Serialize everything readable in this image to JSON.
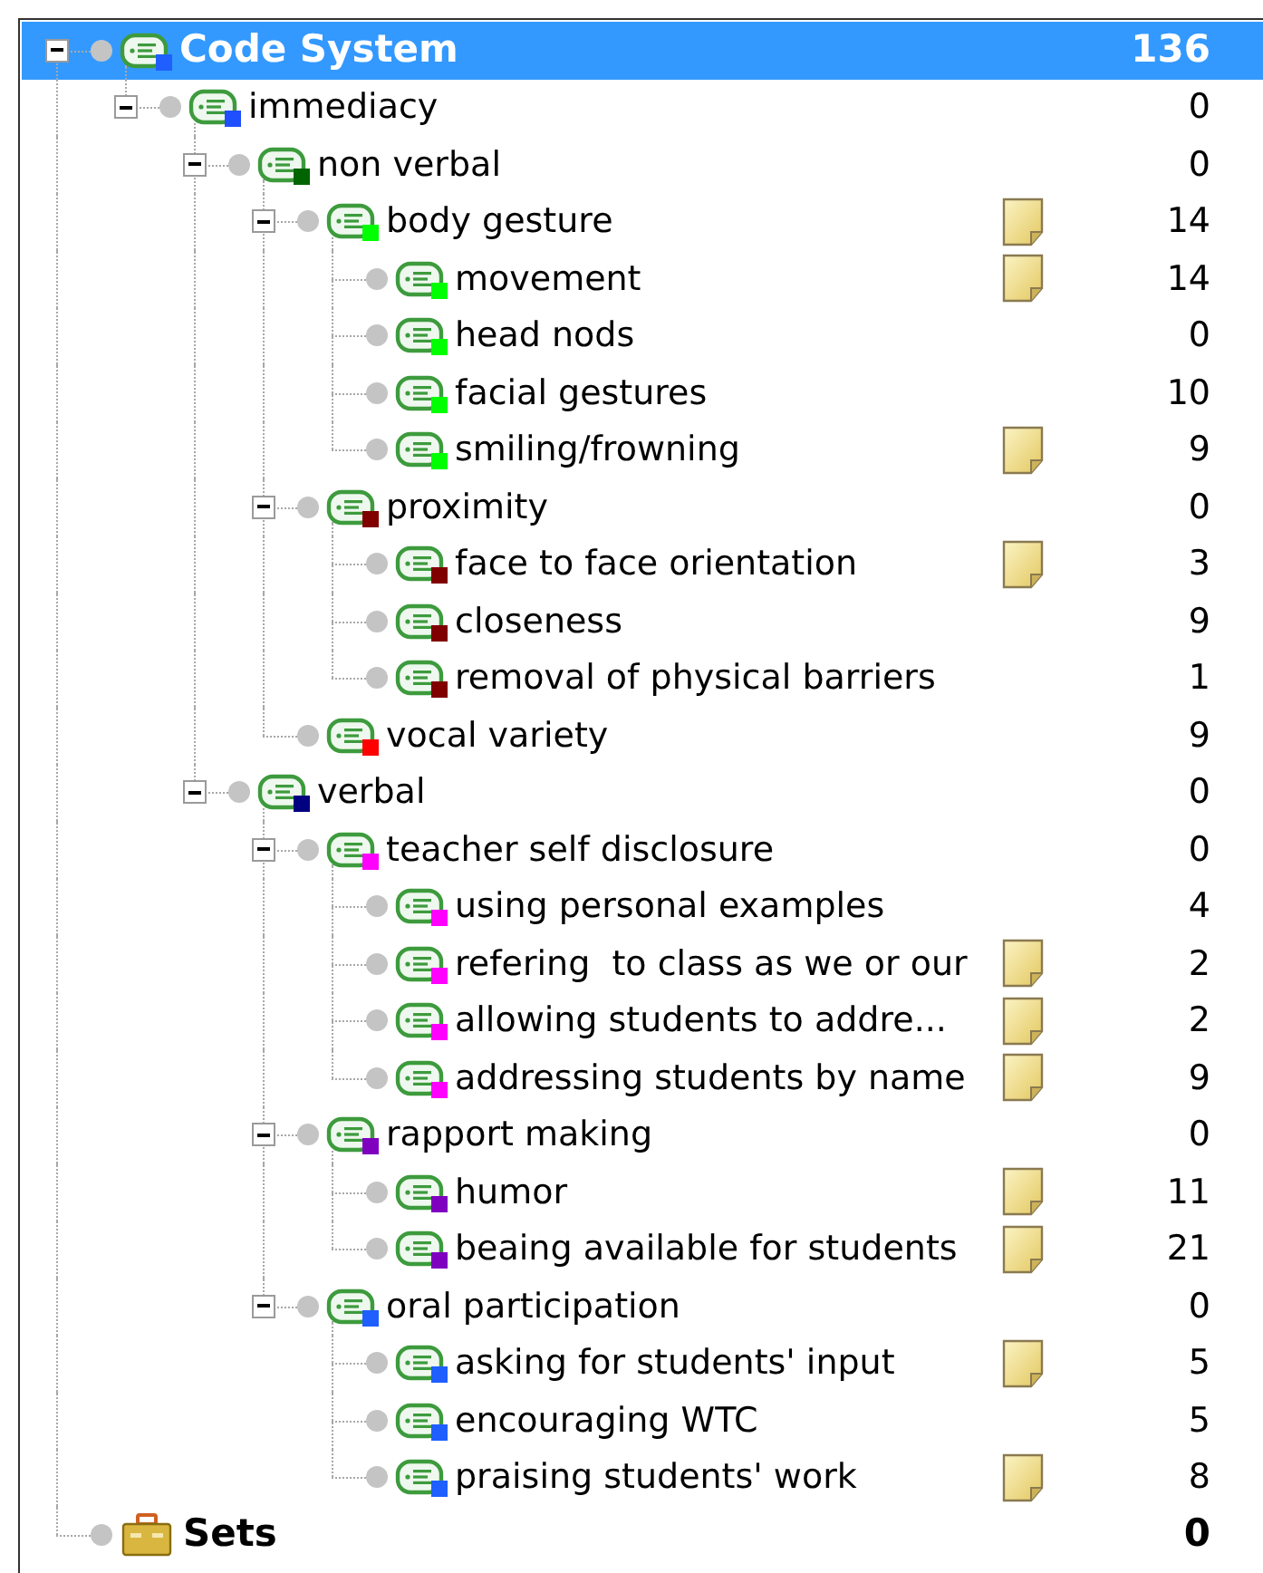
{
  "tree": [
    {
      "kind": "code-system",
      "name": "Code System",
      "count": "136",
      "selected": true,
      "expanded": true,
      "memo": false,
      "color": "#1f5fff",
      "children": [
        {
          "kind": "code",
          "name": "immediacy",
          "count": "0",
          "selected": false,
          "expanded": true,
          "memo": false,
          "color": "#1f4fff",
          "children": [
            {
              "kind": "code",
              "name": "non verbal",
              "count": "0",
              "selected": false,
              "expanded": true,
              "memo": false,
              "color": "#006400",
              "children": [
                {
                  "kind": "code",
                  "name": "body gesture",
                  "count": "14",
                  "selected": false,
                  "expanded": true,
                  "memo": true,
                  "color": "#00ff00",
                  "children": [
                    {
                      "kind": "code",
                      "name": "movement",
                      "count": "14",
                      "selected": false,
                      "memo": true,
                      "color": "#00ff00"
                    },
                    {
                      "kind": "code",
                      "name": "head nods",
                      "count": "0",
                      "selected": false,
                      "memo": false,
                      "color": "#00ff00"
                    },
                    {
                      "kind": "code",
                      "name": "facial gestures",
                      "count": "10",
                      "selected": false,
                      "memo": false,
                      "color": "#00ff00"
                    },
                    {
                      "kind": "code",
                      "name": "smiling/frowning",
                      "count": "9",
                      "selected": false,
                      "memo": true,
                      "color": "#00ff00"
                    }
                  ]
                },
                {
                  "kind": "code",
                  "name": "proximity",
                  "count": "0",
                  "selected": false,
                  "expanded": true,
                  "memo": false,
                  "color": "#800000",
                  "children": [
                    {
                      "kind": "code",
                      "name": "face to face orientation",
                      "count": "3",
                      "selected": false,
                      "memo": true,
                      "color": "#800000"
                    },
                    {
                      "kind": "code",
                      "name": "closeness",
                      "count": "9",
                      "selected": false,
                      "memo": false,
                      "color": "#800000"
                    },
                    {
                      "kind": "code",
                      "name": "removal of physical barriers",
                      "count": "1",
                      "selected": false,
                      "memo": false,
                      "color": "#800000"
                    }
                  ]
                },
                {
                  "kind": "code",
                  "name": "vocal variety",
                  "count": "9",
                  "selected": false,
                  "memo": false,
                  "color": "#ff0000"
                }
              ]
            },
            {
              "kind": "code",
              "name": "verbal",
              "count": "0",
              "selected": false,
              "expanded": true,
              "memo": false,
              "color": "#000080",
              "children": [
                {
                  "kind": "code",
                  "name": "teacher self disclosure",
                  "count": "0",
                  "selected": false,
                  "expanded": true,
                  "memo": false,
                  "color": "#ff00ff",
                  "children": [
                    {
                      "kind": "code",
                      "name": "using personal examples",
                      "count": "4",
                      "selected": false,
                      "memo": false,
                      "color": "#ff00ff"
                    },
                    {
                      "kind": "code",
                      "name": "refering  to class as we or our",
                      "count": "2",
                      "selected": false,
                      "memo": true,
                      "color": "#ff00ff"
                    },
                    {
                      "kind": "code",
                      "name": "allowing students to addre...",
                      "count": "2",
                      "selected": false,
                      "memo": true,
                      "color": "#ff00ff"
                    },
                    {
                      "kind": "code",
                      "name": "addressing students by name",
                      "count": "9",
                      "selected": false,
                      "memo": true,
                      "color": "#ff00ff"
                    }
                  ]
                },
                {
                  "kind": "code",
                  "name": "rapport making",
                  "count": "0",
                  "selected": false,
                  "expanded": true,
                  "memo": false,
                  "color": "#8000c0",
                  "children": [
                    {
                      "kind": "code",
                      "name": "humor",
                      "count": "11",
                      "selected": false,
                      "memo": true,
                      "color": "#8000c0"
                    },
                    {
                      "kind": "code",
                      "name": "beaing available for students",
                      "count": "21",
                      "selected": false,
                      "memo": true,
                      "color": "#8000c0"
                    }
                  ]
                },
                {
                  "kind": "code",
                  "name": "oral participation",
                  "count": "0",
                  "selected": false,
                  "expanded": true,
                  "memo": false,
                  "color": "#1f5fff",
                  "children": [
                    {
                      "kind": "code",
                      "name": "asking for students' input",
                      "count": "5",
                      "selected": false,
                      "memo": true,
                      "color": "#1f5fff"
                    },
                    {
                      "kind": "code",
                      "name": "encouraging WTC",
                      "count": "5",
                      "selected": false,
                      "memo": false,
                      "color": "#1f5fff"
                    },
                    {
                      "kind": "code",
                      "name": "praising students' work",
                      "count": "8",
                      "selected": false,
                      "memo": true,
                      "color": "#1f5fff"
                    }
                  ]
                }
              ]
            }
          ]
        }
      ]
    },
    {
      "kind": "sets",
      "name": "Sets",
      "count": "0",
      "selected": false
    }
  ]
}
